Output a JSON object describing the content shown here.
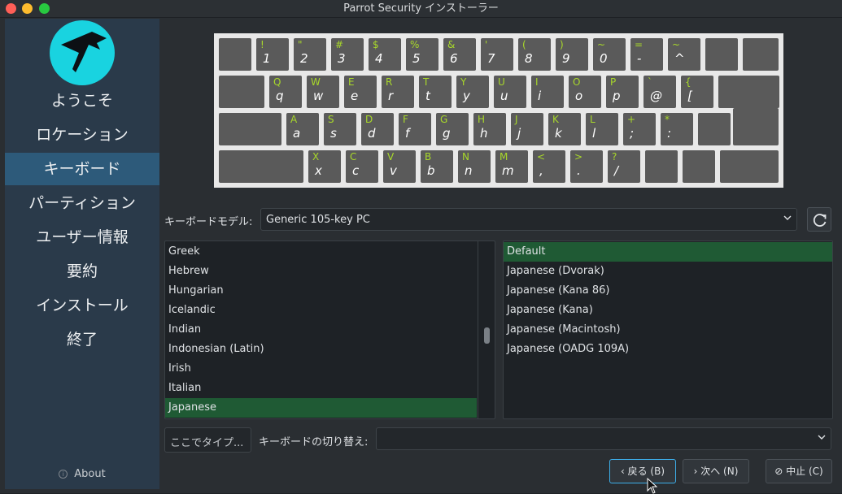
{
  "window": {
    "title": "Parrot Security インストーラー"
  },
  "sidebar": {
    "items": [
      {
        "label": "ようこそ"
      },
      {
        "label": "ロケーション"
      },
      {
        "label": "キーボード"
      },
      {
        "label": "パーティション"
      },
      {
        "label": "ユーザー情報"
      },
      {
        "label": "要約"
      },
      {
        "label": "インストール"
      },
      {
        "label": "終了"
      }
    ],
    "active_index": 2,
    "about_label": "About"
  },
  "keyboard": {
    "row1": [
      {
        "up": "",
        "lo": ""
      },
      {
        "up": "!",
        "lo": "1"
      },
      {
        "up": "\"",
        "lo": "2"
      },
      {
        "up": "#",
        "lo": "3"
      },
      {
        "up": "$",
        "lo": "4"
      },
      {
        "up": "%",
        "lo": "5"
      },
      {
        "up": "&",
        "lo": "6"
      },
      {
        "up": "'",
        "lo": "7"
      },
      {
        "up": "(",
        "lo": "8"
      },
      {
        "up": ")",
        "lo": "9"
      },
      {
        "up": "~",
        "lo": "0"
      },
      {
        "up": "=",
        "lo": "-"
      },
      {
        "up": "~",
        "lo": "^"
      },
      {
        "up": "",
        "lo": ""
      },
      {
        "up": "",
        "lo": ""
      }
    ],
    "row2": [
      {
        "up": "",
        "lo": ""
      },
      {
        "up": "Q",
        "lo": "q"
      },
      {
        "up": "W",
        "lo": "w"
      },
      {
        "up": "E",
        "lo": "e"
      },
      {
        "up": "R",
        "lo": "r"
      },
      {
        "up": "T",
        "lo": "t"
      },
      {
        "up": "Y",
        "lo": "y"
      },
      {
        "up": "U",
        "lo": "u"
      },
      {
        "up": "I",
        "lo": "i"
      },
      {
        "up": "O",
        "lo": "o"
      },
      {
        "up": "P",
        "lo": "p"
      },
      {
        "up": "`",
        "lo": "@"
      },
      {
        "up": "{",
        "lo": "["
      },
      {
        "up": "",
        "lo": ""
      }
    ],
    "row3": [
      {
        "up": "",
        "lo": ""
      },
      {
        "up": "A",
        "lo": "a"
      },
      {
        "up": "S",
        "lo": "s"
      },
      {
        "up": "D",
        "lo": "d"
      },
      {
        "up": "F",
        "lo": "f"
      },
      {
        "up": "G",
        "lo": "g"
      },
      {
        "up": "H",
        "lo": "h"
      },
      {
        "up": "J",
        "lo": "j"
      },
      {
        "up": "K",
        "lo": "k"
      },
      {
        "up": "L",
        "lo": "l"
      },
      {
        "up": "+",
        "lo": ";"
      },
      {
        "up": "*",
        "lo": ":"
      },
      {
        "up": "",
        "lo": ""
      }
    ],
    "row4": [
      {
        "up": "",
        "lo": ""
      },
      {
        "up": "X",
        "lo": "x"
      },
      {
        "up": "C",
        "lo": "c"
      },
      {
        "up": "V",
        "lo": "v"
      },
      {
        "up": "B",
        "lo": "b"
      },
      {
        "up": "N",
        "lo": "n"
      },
      {
        "up": "M",
        "lo": "m"
      },
      {
        "up": "<",
        "lo": ","
      },
      {
        "up": ">",
        "lo": "."
      },
      {
        "up": "?",
        "lo": "/"
      },
      {
        "up": "",
        "lo": ""
      },
      {
        "up": "",
        "lo": ""
      },
      {
        "up": "",
        "lo": ""
      }
    ]
  },
  "model": {
    "label": "キーボードモデル:",
    "value": "Generic 105-key PC"
  },
  "layouts": {
    "items": [
      "Greek",
      "Hebrew",
      "Hungarian",
      "Icelandic",
      "Indian",
      "Indonesian (Latin)",
      "Irish",
      "Italian",
      "Japanese"
    ],
    "selected": "Japanese"
  },
  "variants": {
    "items": [
      "Default",
      "Japanese (Dvorak)",
      "Japanese (Kana 86)",
      "Japanese (Kana)",
      "Japanese (Macintosh)",
      "Japanese (OADG 109A)"
    ],
    "selected": "Default"
  },
  "test_input": {
    "placeholder": "ここでタイプ..."
  },
  "switch": {
    "label": "キーボードの切り替え:",
    "value": ""
  },
  "buttons": {
    "back": "戻る (B)",
    "next": "次へ (N)",
    "cancel": "中止 (C)"
  },
  "colors": {
    "accent": "#3daee9",
    "sidebar_active": "#2d5a7a",
    "selection": "#1f5a34",
    "key_upper": "#a8d82a"
  },
  "icons": {
    "logo": "parrot-logo",
    "reset": "reset-icon",
    "about": "info-icon"
  }
}
